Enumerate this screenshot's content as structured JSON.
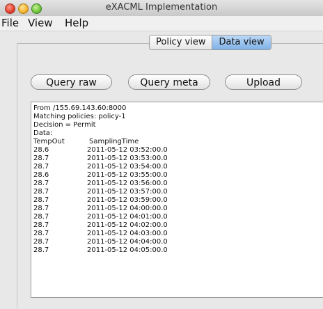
{
  "window": {
    "title": "eXACML Implementation"
  },
  "menu": {
    "file": "File",
    "view": "View",
    "help": "Help"
  },
  "tabs": {
    "policy": "Policy view",
    "data": "Data view"
  },
  "buttons": {
    "query_raw": "Query raw",
    "query_meta": "Query meta",
    "upload": "Upload"
  },
  "output": {
    "from": "From /155.69.143.60:8000",
    "matching": "Matching policies: policy-1",
    "decision": " Decision = Permit",
    "data_label": "Data:",
    "col_temp": "TempOut",
    "col_time": "SamplingTime",
    "rows": [
      {
        "temp": "28.6",
        "time": "2011-05-12 03:52:00.0"
      },
      {
        "temp": "28.7",
        "time": "2011-05-12 03:53:00.0"
      },
      {
        "temp": "28.7",
        "time": "2011-05-12 03:54:00.0"
      },
      {
        "temp": "28.6",
        "time": "2011-05-12 03:55:00.0"
      },
      {
        "temp": "28.7",
        "time": "2011-05-12 03:56:00.0"
      },
      {
        "temp": "28.7",
        "time": "2011-05-12 03:57:00.0"
      },
      {
        "temp": "28.7",
        "time": "2011-05-12 03:59:00.0"
      },
      {
        "temp": "28.7",
        "time": "2011-05-12 04:00:00.0"
      },
      {
        "temp": "28.7",
        "time": "2011-05-12 04:01:00.0"
      },
      {
        "temp": "28.7",
        "time": "2011-05-12 04:02:00.0"
      },
      {
        "temp": "28.7",
        "time": "2011-05-12 04:03:00.0"
      },
      {
        "temp": "28.7",
        "time": "2011-05-12 04:04:00.0"
      },
      {
        "temp": "28.7",
        "time": "2011-05-12 04:05:00.0"
      }
    ]
  },
  "colors": {
    "selected_tab": "#8fbdec",
    "background": "#e8e8e8"
  }
}
